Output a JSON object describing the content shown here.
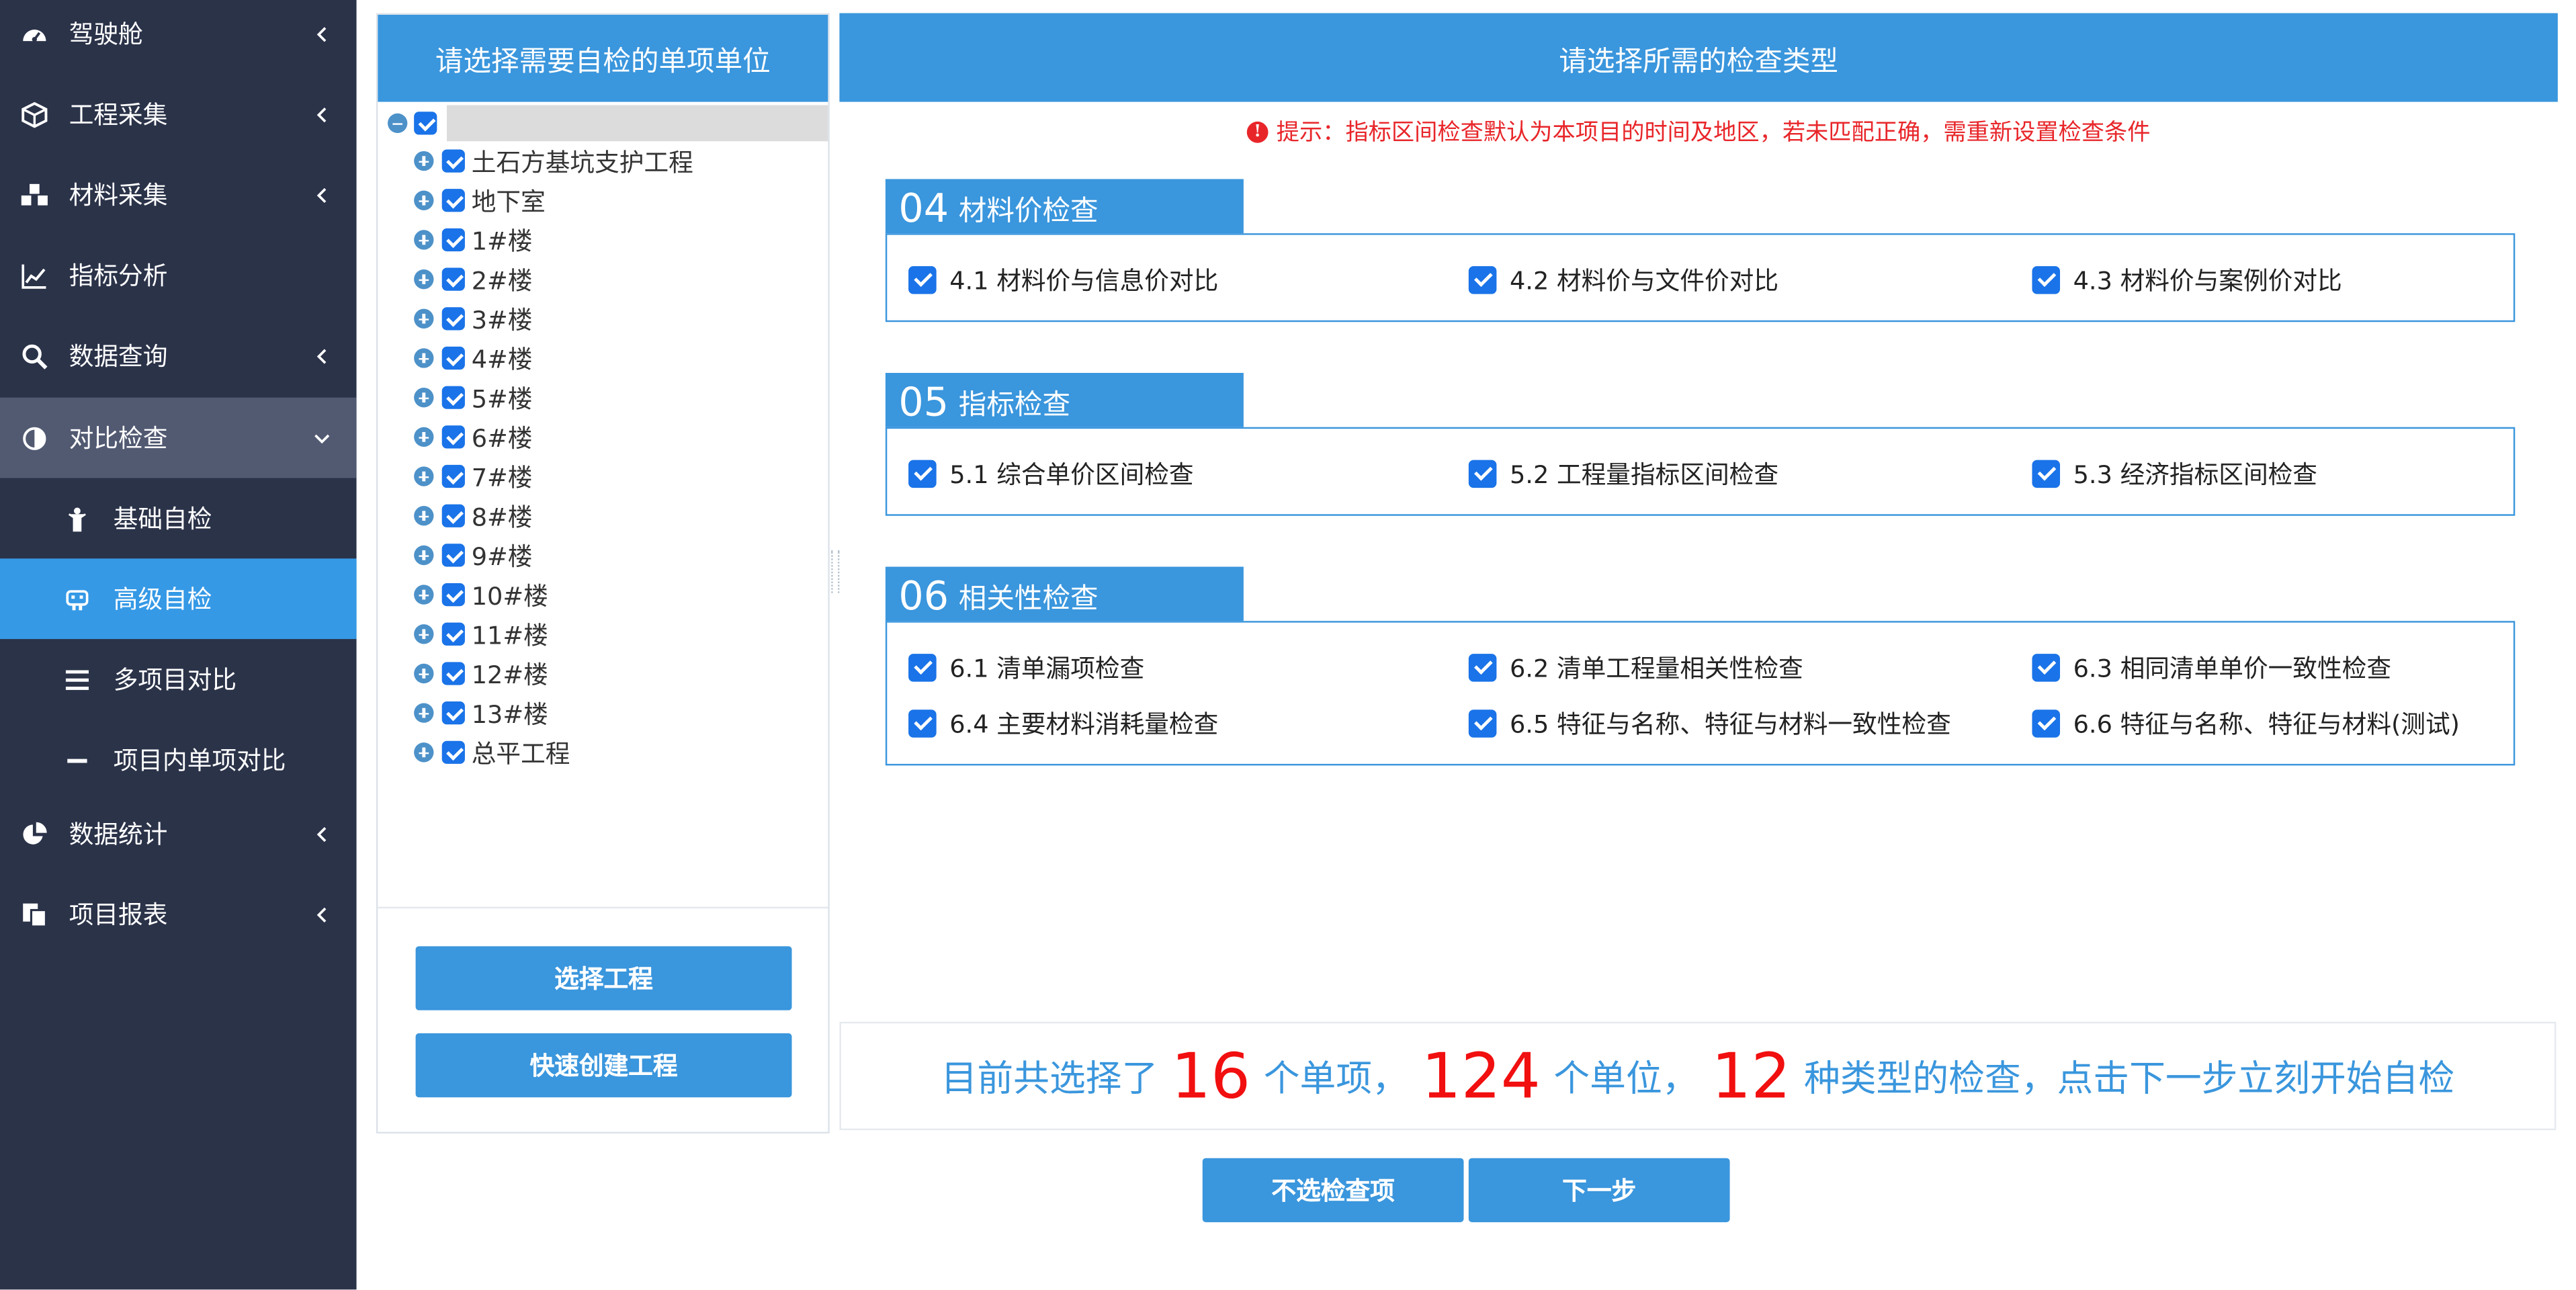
{
  "sidebar": {
    "items": [
      {
        "label": "驾驶舱",
        "icon": "dashboard-icon",
        "chevron": "chevron-left-icon"
      },
      {
        "label": "工程采集",
        "icon": "cube-icon",
        "chevron": "chevron-left-icon"
      },
      {
        "label": "材料采集",
        "icon": "cubes-icon",
        "chevron": "chevron-left-icon"
      },
      {
        "label": "指标分析",
        "icon": "line-chart-icon"
      },
      {
        "label": "数据查询",
        "icon": "search-icon",
        "chevron": "chevron-left-icon"
      },
      {
        "label": "对比检查",
        "icon": "contrast-icon",
        "chevron": "chevron-down-icon",
        "expanded": true
      },
      {
        "label": "基础自检",
        "icon": "child-icon",
        "sub": true
      },
      {
        "label": "高级自检",
        "icon": "robot-icon",
        "sub": true,
        "active": true
      },
      {
        "label": "多项目对比",
        "icon": "bars-icon",
        "sub": true
      },
      {
        "label": "项目内单项对比",
        "icon": "minus-icon",
        "sub": true
      },
      {
        "label": "数据统计",
        "icon": "pie-chart-icon",
        "chevron": "chevron-left-icon"
      },
      {
        "label": "项目报表",
        "icon": "files-icon",
        "chevron": "chevron-left-icon"
      }
    ]
  },
  "left_panel": {
    "title": "请选择需要自检的单项单位",
    "tree_items": [
      "土石方基坑支护工程",
      "地下室",
      "1#楼",
      "2#楼",
      "3#楼",
      "4#楼",
      "5#楼",
      "6#楼",
      "7#楼",
      "8#楼",
      "9#楼",
      "10#楼",
      "11#楼",
      "12#楼",
      "13#楼",
      "总平工程"
    ],
    "select_button": "选择工程",
    "quick_create_button": "快速创建工程"
  },
  "right_panel": {
    "title": "请选择所需的检查类型",
    "hint": "提示：指标区间检查默认为本项目的时间及地区，若未匹配正确，需重新设置检查条件",
    "sections": [
      {
        "num": "04",
        "title": "材料价检查",
        "items": [
          "4.1 材料价与信息价对比",
          "4.2 材料价与文件价对比",
          "4.3 材料价与案例价对比"
        ]
      },
      {
        "num": "05",
        "title": "指标检查",
        "items": [
          "5.1 综合单价区间检查",
          "5.2 工程量指标区间检查",
          "5.3 经济指标区间检查"
        ]
      },
      {
        "num": "06",
        "title": "相关性检查",
        "items": [
          "6.1 清单漏项检查",
          "6.2 清单工程量相关性检查",
          "6.3 相同清单单价一致性检查",
          "6.4 主要材料消耗量检查",
          "6.5 特征与名称、特征与材料一致性检查",
          "6.6 特征与名称、特征与材料(测试)"
        ]
      }
    ],
    "summary": {
      "prefix": "目前共选择了",
      "items_count": "16",
      "text1": "个单项，",
      "units_count": "124",
      "text2": "个单位，",
      "types_count": "12",
      "text3": "种类型的检查，点击下一步立刻开始自检"
    },
    "deselect_button": "不选检查项",
    "next_button": "下一步"
  },
  "colors": {
    "sidebar_bg": "#2b3349",
    "accent": "#3a96dd",
    "alert": "#e8262a",
    "checkbox": "#1a73e8"
  }
}
